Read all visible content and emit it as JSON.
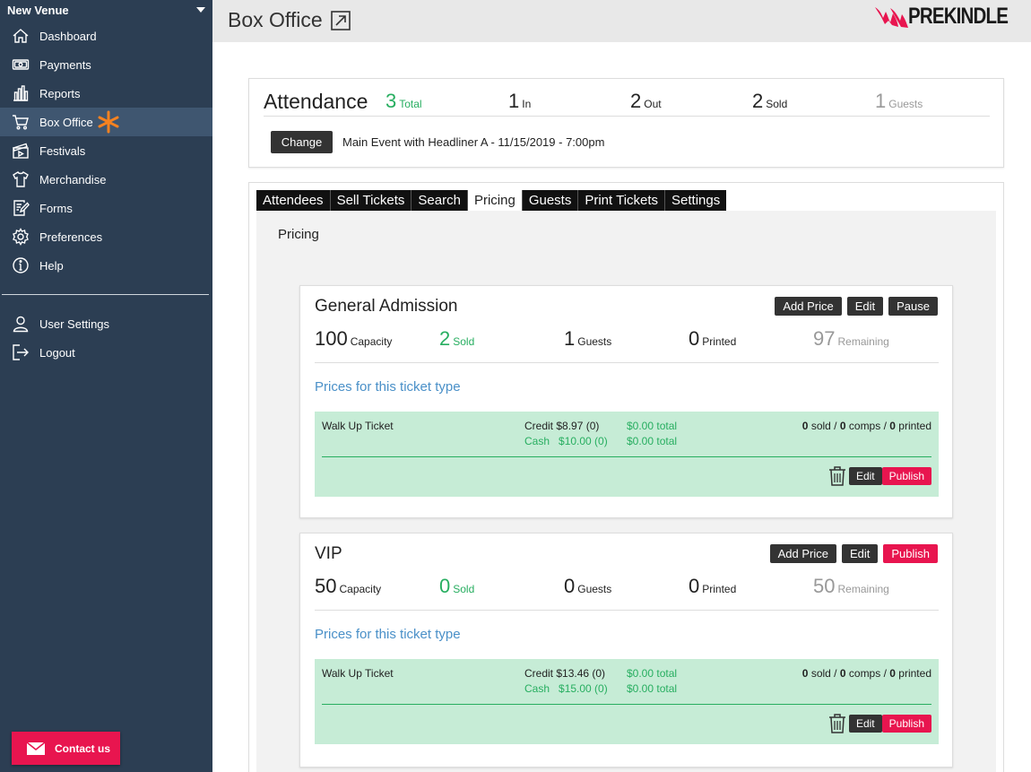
{
  "sidebar": {
    "venue": "New Venue",
    "items": [
      {
        "label": "Dashboard",
        "icon": "home-icon"
      },
      {
        "label": "Payments",
        "icon": "money-icon"
      },
      {
        "label": "Reports",
        "icon": "bar-chart-icon"
      },
      {
        "label": "Box Office",
        "icon": "cart-icon",
        "active": true
      },
      {
        "label": "Festivals",
        "icon": "clapperboard-icon"
      },
      {
        "label": "Merchandise",
        "icon": "shirt-icon"
      },
      {
        "label": "Forms",
        "icon": "form-icon"
      },
      {
        "label": "Preferences",
        "icon": "gear-icon"
      },
      {
        "label": "Help",
        "icon": "info-icon"
      }
    ],
    "bottom_items": [
      {
        "label": "User Settings",
        "icon": "user-icon"
      },
      {
        "label": "Logout",
        "icon": "logout-icon"
      }
    ],
    "contact_label": "Contact us"
  },
  "header": {
    "title": "Box Office",
    "logo_text": "PREKINDLE"
  },
  "attendance": {
    "title": "Attendance",
    "total": "3",
    "total_label": "Total",
    "in": "1",
    "in_label": "In",
    "out": "2",
    "out_label": "Out",
    "sold": "2",
    "sold_label": "Sold",
    "guests": "1",
    "guests_label": "Guests",
    "change_label": "Change",
    "event": "Main Event with Headliner A - 11/15/2019 - 7:00pm"
  },
  "tabs": [
    "Attendees",
    "Sell Tickets",
    "Search",
    "Pricing",
    "Guests",
    "Print Tickets",
    "Settings"
  ],
  "active_tab": "Pricing",
  "section_label": "Pricing",
  "ticket_types": [
    {
      "name": "General Admission",
      "actions": [
        "Add Price",
        "Edit",
        "Pause"
      ],
      "capacity": "100",
      "capacity_label": "Capacity",
      "sold": "2",
      "sold_label": "Sold",
      "guests": "1",
      "guests_label": "Guests",
      "printed": "0",
      "printed_label": "Printed",
      "remaining": "97",
      "remaining_label": "Remaining",
      "prices_link": "Prices for this ticket type",
      "price": {
        "name": "Walk Up Ticket",
        "credit": "Credit $8.97 (0)",
        "credit_total": "$0.00 total",
        "cash": "Cash   $10.00 (0)",
        "cash_total": "$0.00 total",
        "sold": "0",
        "comps": "0",
        "printed": "0",
        "edit_label": "Edit",
        "publish_label": "Publish"
      }
    },
    {
      "name": "VIP",
      "actions": [
        "Add Price",
        "Edit",
        "Publish"
      ],
      "capacity": "50",
      "capacity_label": "Capacity",
      "sold": "0",
      "sold_label": "Sold",
      "guests": "0",
      "guests_label": "Guests",
      "printed": "0",
      "printed_label": "Printed",
      "remaining": "50",
      "remaining_label": "Remaining",
      "prices_link": "Prices for this ticket type",
      "price": {
        "name": "Walk Up Ticket",
        "credit": "Credit $13.46 (0)",
        "credit_total": "$0.00 total",
        "cash": "Cash   $15.00 (0)",
        "cash_total": "$0.00 total",
        "sold": "0",
        "comps": "0",
        "printed": "0",
        "edit_label": "Edit",
        "publish_label": "Publish"
      }
    }
  ],
  "labels": {
    "sold_word": "sold",
    "comps_word": "comps",
    "printed_word": "printed",
    "sep": "/"
  },
  "colors": {
    "sidebar": "#2c3e53",
    "accent_pink": "#e8154f",
    "green": "#27ae60",
    "price_bg": "#c6ecd6",
    "star": "#f58220"
  }
}
